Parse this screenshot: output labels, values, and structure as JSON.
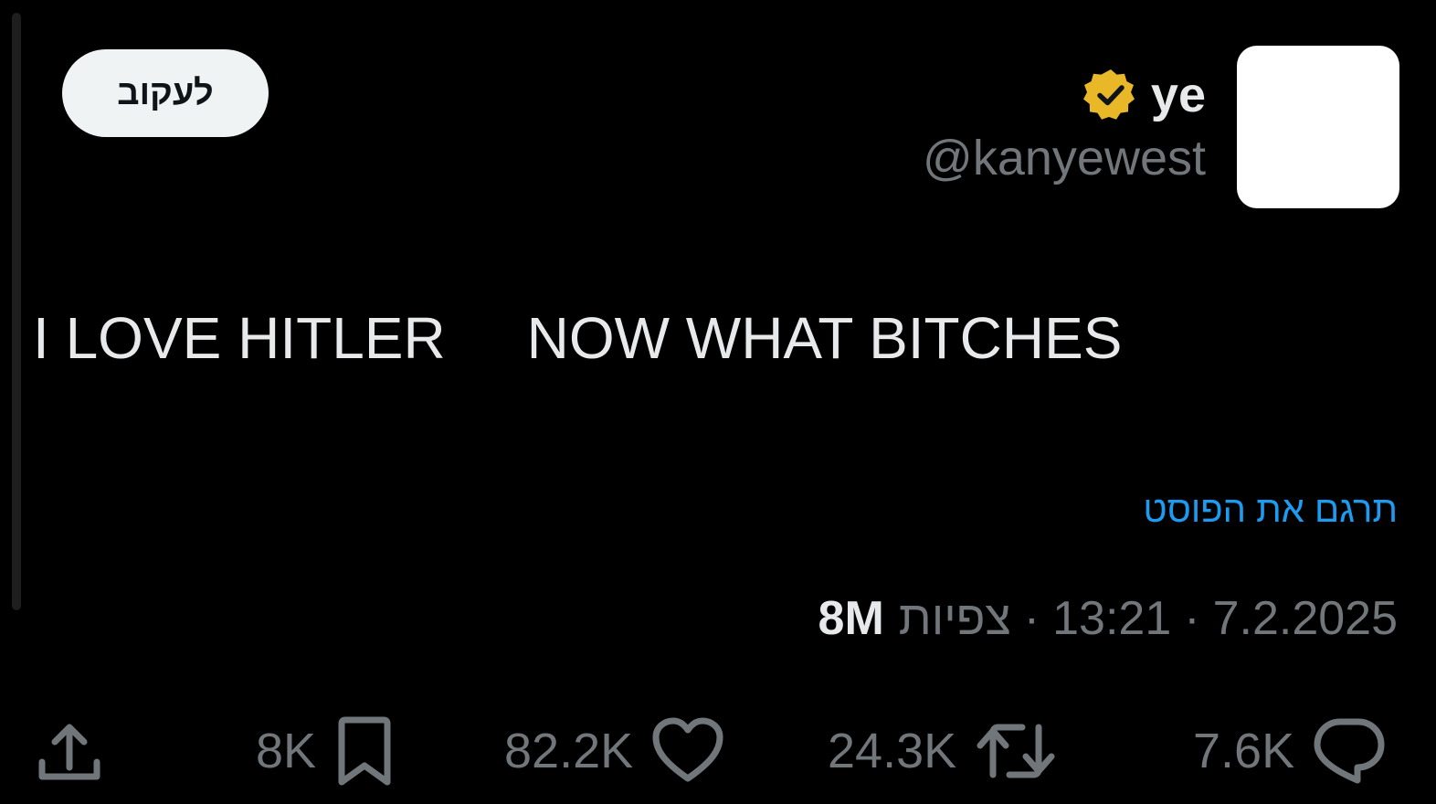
{
  "author": {
    "display_name": "ye",
    "handle": "@kanyewest",
    "verified_badge_icon": "verified-badge-icon",
    "verified_badge_color": "#e8b829"
  },
  "follow_button": {
    "label": "לעקוב"
  },
  "post": {
    "text": "I LOVE HITLER     NOW WHAT BITCHES"
  },
  "translate": {
    "label": "תרגם את הפוסט",
    "color": "#1d9bf0"
  },
  "meta": {
    "date": "7.2.2025",
    "separator": "·",
    "time": "13:21",
    "views_label": "צפיות",
    "views_count": "8M"
  },
  "actions": {
    "reply": {
      "icon": "reply-icon",
      "count": "7.6K"
    },
    "repost": {
      "icon": "repost-icon",
      "count": "24.3K"
    },
    "like": {
      "icon": "heart-icon",
      "count": "82.2K"
    },
    "bookmark": {
      "icon": "bookmark-icon",
      "count": "8K"
    },
    "share": {
      "icon": "share-icon"
    }
  },
  "colors": {
    "background": "#000000",
    "primary_text": "#e7e9ea",
    "secondary_text": "#71767b",
    "follow_button_bg": "#eff3f4"
  }
}
